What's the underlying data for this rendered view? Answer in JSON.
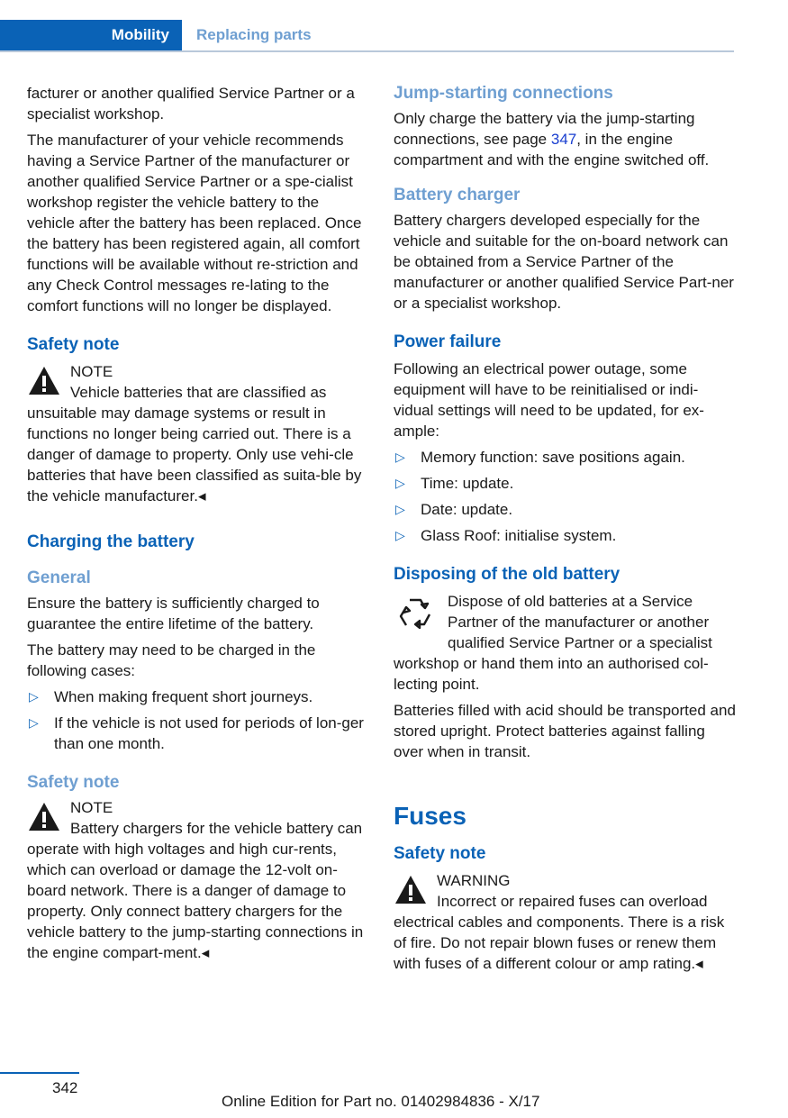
{
  "header": {
    "section": "Mobility",
    "subsection": "Replacing parts"
  },
  "left": {
    "p1": "facturer or another qualified Service Partner or a specialist workshop.",
    "p2": "The manufacturer of your vehicle recommends having a Service Partner of the manufacturer or another qualified Service Partner or a spe-cialist workshop register the vehicle battery to the vehicle after the battery has been replaced. Once the battery has been registered again, all comfort functions will be available without re-striction and any Check Control messages re-lating to the comfort functions will no longer be displayed.",
    "safety1_heading": "Safety note",
    "safety1_label": "NOTE",
    "safety1_text": "Vehicle batteries that are classified as unsuitable may damage systems or result in functions no longer being carried out. There is a danger of damage to property. Only use vehi-cle batteries that have been classified as suita-ble by the vehicle manufacturer.◂",
    "charging_heading": "Charging the battery",
    "general_heading": "General",
    "general_p1": "Ensure the battery is sufficiently charged to guarantee the entire lifetime of the battery.",
    "general_p2": "The battery may need to be charged in the following cases:",
    "cases": [
      "When making frequent short journeys.",
      "If the vehicle is not used for periods of lon-ger than one month."
    ],
    "safety2_heading": "Safety note",
    "safety2_label": "NOTE",
    "safety2_text": "Battery chargers for the vehicle battery can operate with high voltages and high cur-rents, which can overload or damage the 12-volt on-board network. There is a danger of damage to property. Only connect battery chargers for the vehicle battery to the jump-starting connections in the engine compart-ment.◂"
  },
  "right": {
    "jump_heading": "Jump-starting connections",
    "jump_text_a": "Only charge the battery via the jump-starting connections, see page ",
    "jump_page": "347",
    "jump_text_b": ", in the engine compartment and with the engine switched off.",
    "charger_heading": "Battery charger",
    "charger_text": "Battery chargers developed especially for the vehicle and suitable for the on-board network can be obtained from a Service Partner of the manufacturer or another qualified Service Part-ner or a specialist workshop.",
    "power_heading": "Power failure",
    "power_text": "Following an electrical power outage, some equipment will have to be reinitialised or indi-vidual settings will need to be updated, for ex-ample:",
    "power_items": [
      "Memory function: save positions again.",
      "Time: update.",
      "Date: update.",
      "Glass Roof: initialise system."
    ],
    "dispose_heading": "Disposing of the old battery",
    "dispose_text": "Dispose of old batteries at a Service Partner of the manufacturer or another qualified Service Partner or a specialist workshop or hand them into an authorised col-lecting point.",
    "dispose_p2": "Batteries filled with acid should be transported and stored upright. Protect batteries against falling over when in transit.",
    "fuses_heading": "Fuses",
    "fuses_safety_heading": "Safety note",
    "fuses_label": "WARNING",
    "fuses_text": "Incorrect or repaired fuses can overload electrical cables and components. There is a risk of fire. Do not repair blown fuses or renew them with fuses of a different colour or amp rating.◂"
  },
  "footer": {
    "page_number": "342",
    "edition": "Online Edition for Part no. 01402984836 - X/17"
  }
}
